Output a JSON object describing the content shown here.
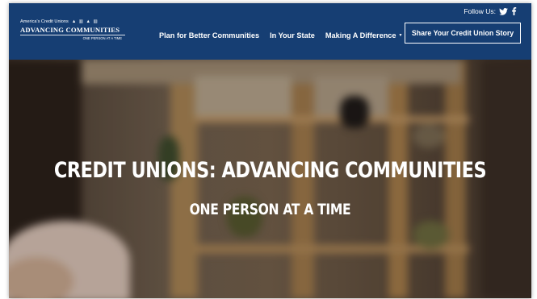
{
  "logo": {
    "tagline": "America's Credit Unions",
    "title": "ADVANCING COMMUNITIES",
    "subtitle": "ONE PERSON AT A TIME"
  },
  "follow": {
    "label": "Follow Us:"
  },
  "nav": {
    "items": [
      {
        "label": "Plan for Better Communities"
      },
      {
        "label": "In Your State"
      },
      {
        "label": "Making A Difference"
      }
    ],
    "cta_label": "Share Your Credit Union Story"
  },
  "hero": {
    "title": "CREDIT UNIONS: ADVANCING COMMUNITIES",
    "subtitle": "ONE PERSON AT A TIME"
  },
  "colors": {
    "header_bg": "#163e73",
    "text": "#ffffff"
  }
}
